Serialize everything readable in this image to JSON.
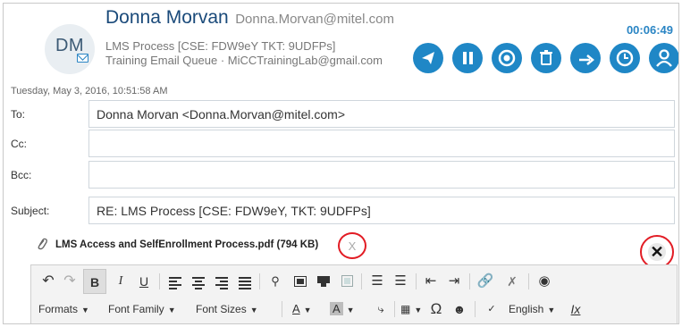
{
  "header": {
    "avatar_initials": "DM",
    "contact_name": "Donna Morvan",
    "contact_email": "Donna.Morvan@mitel.com",
    "case_line": "LMS Process [CSE: FDW9eY TKT: 9UDFPs]",
    "queue_line": "Training Email Queue · MiCCTrainingLab@gmail.com",
    "timer": "00:06:49",
    "accent_color": "#1f87c6",
    "actions": [
      {
        "name": "send-icon"
      },
      {
        "name": "pause-icon"
      },
      {
        "name": "wrapup-icon"
      },
      {
        "name": "trash-icon"
      },
      {
        "name": "transfer-icon"
      },
      {
        "name": "schedule-icon"
      },
      {
        "name": "contacts-icon"
      }
    ]
  },
  "date": "Tuesday, May 3, 2016, 10:51:58 AM",
  "fields": {
    "to_label": "To:",
    "to_value": "Donna Morvan <Donna.Morvan@mitel.com>",
    "cc_label": "Cc:",
    "cc_value": "",
    "bcc_label": "Bcc:",
    "bcc_value": "",
    "subject_label": "Subject:",
    "subject_value": "RE: LMS Process [CSE: FDW9eY, TKT: 9UDFPs]"
  },
  "attachment": {
    "name": "LMS Access and SelfEnrollment Process.pdf (794 KB)",
    "remove_label": "X",
    "close_label": "✕",
    "highlight_color": "#e21c24"
  },
  "toolbar": {
    "undo": "↶",
    "redo": "↷",
    "bold": "B",
    "italic": "I",
    "underline": "U",
    "formats": "Formats",
    "font_family": "Font Family",
    "font_sizes": "Font Sizes",
    "text_color": "A",
    "bg_color": "A",
    "omega": "Ω",
    "language": "English",
    "clear_format": "Ix"
  }
}
